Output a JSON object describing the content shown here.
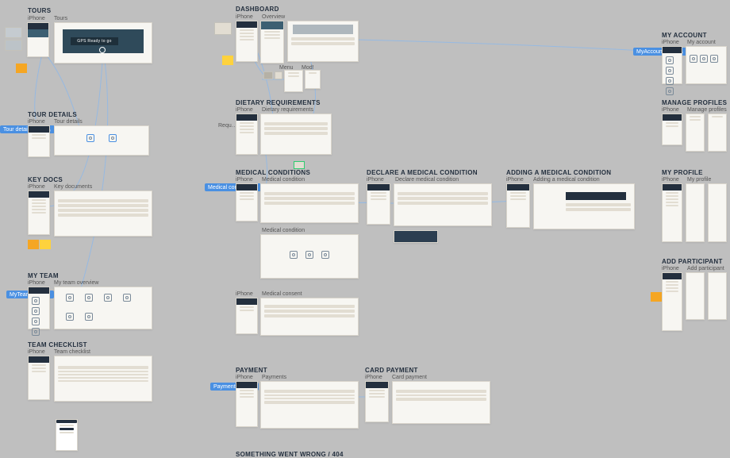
{
  "sections": {
    "tours": {
      "title": "TOURS",
      "iphone": "iPhone",
      "web": "Tours",
      "heroText": "GPS Ready to go"
    },
    "dashboard": {
      "title": "DASHBOARD",
      "iphone": "iPhone",
      "web": "Overview",
      "menu": "Menu",
      "modal": "Mod!"
    },
    "my_account": {
      "title": "MY ACCOUNT",
      "iphone": "iPhone",
      "web": "My account",
      "flow": "MyAccount flow"
    },
    "tour_details": {
      "title": "TOUR DETAILS",
      "iphone": "iPhone",
      "web": "Tour details",
      "flow": "Tour details flow"
    },
    "dietary": {
      "title": "DIETARY REQUIREMENTS",
      "iphone": "iPhone",
      "web": "Dietary requirements",
      "requ": "Requ…"
    },
    "manage_profiles": {
      "title": "MANAGE PROFILES",
      "iphone": "iPhone",
      "web": "Manage profiles"
    },
    "key_docs": {
      "title": "KEY DOCS",
      "iphone": "iPhone",
      "web": "Key documents"
    },
    "medical_conditions": {
      "title": "MEDICAL CONDITIONS",
      "iphone": "iPhone",
      "web": "Medical condition",
      "flow": "Medical conditi…",
      "row2": "Medical condition",
      "consent_iphone": "iPhone",
      "consent": "Medical consent"
    },
    "declare_medical": {
      "title": "DECLARE A MEDICAL CONDITION",
      "iphone": "iPhone",
      "web": "Declare medical condition"
    },
    "adding_medical": {
      "title": "ADDING A MEDICAL CONDITION",
      "iphone": "iPhone",
      "web": "Adding a medical condition"
    },
    "my_profile": {
      "title": "MY PROFILE",
      "iphone": "iPhone",
      "web": "My profile"
    },
    "my_team": {
      "title": "MY TEAM",
      "iphone": "iPhone",
      "web": "My team overview",
      "flow": "MyTeam flow"
    },
    "add_participant": {
      "title": "ADD PARTICIPANT",
      "iphone": "iPhone",
      "web": "Add participant"
    },
    "team_checklist": {
      "title": "TEAM CHECKLIST",
      "iphone": "iPhone",
      "web": "Team checklist"
    },
    "payment": {
      "title": "PAYMENT",
      "iphone": "iPhone",
      "web": "Payments",
      "flow": "Payment flow"
    },
    "card_payment": {
      "title": "CARD PAYMENT",
      "iphone": "iPhone",
      "web": "Card payment"
    },
    "error": {
      "title": "SOMETHING WENT WRONG / 404"
    }
  }
}
